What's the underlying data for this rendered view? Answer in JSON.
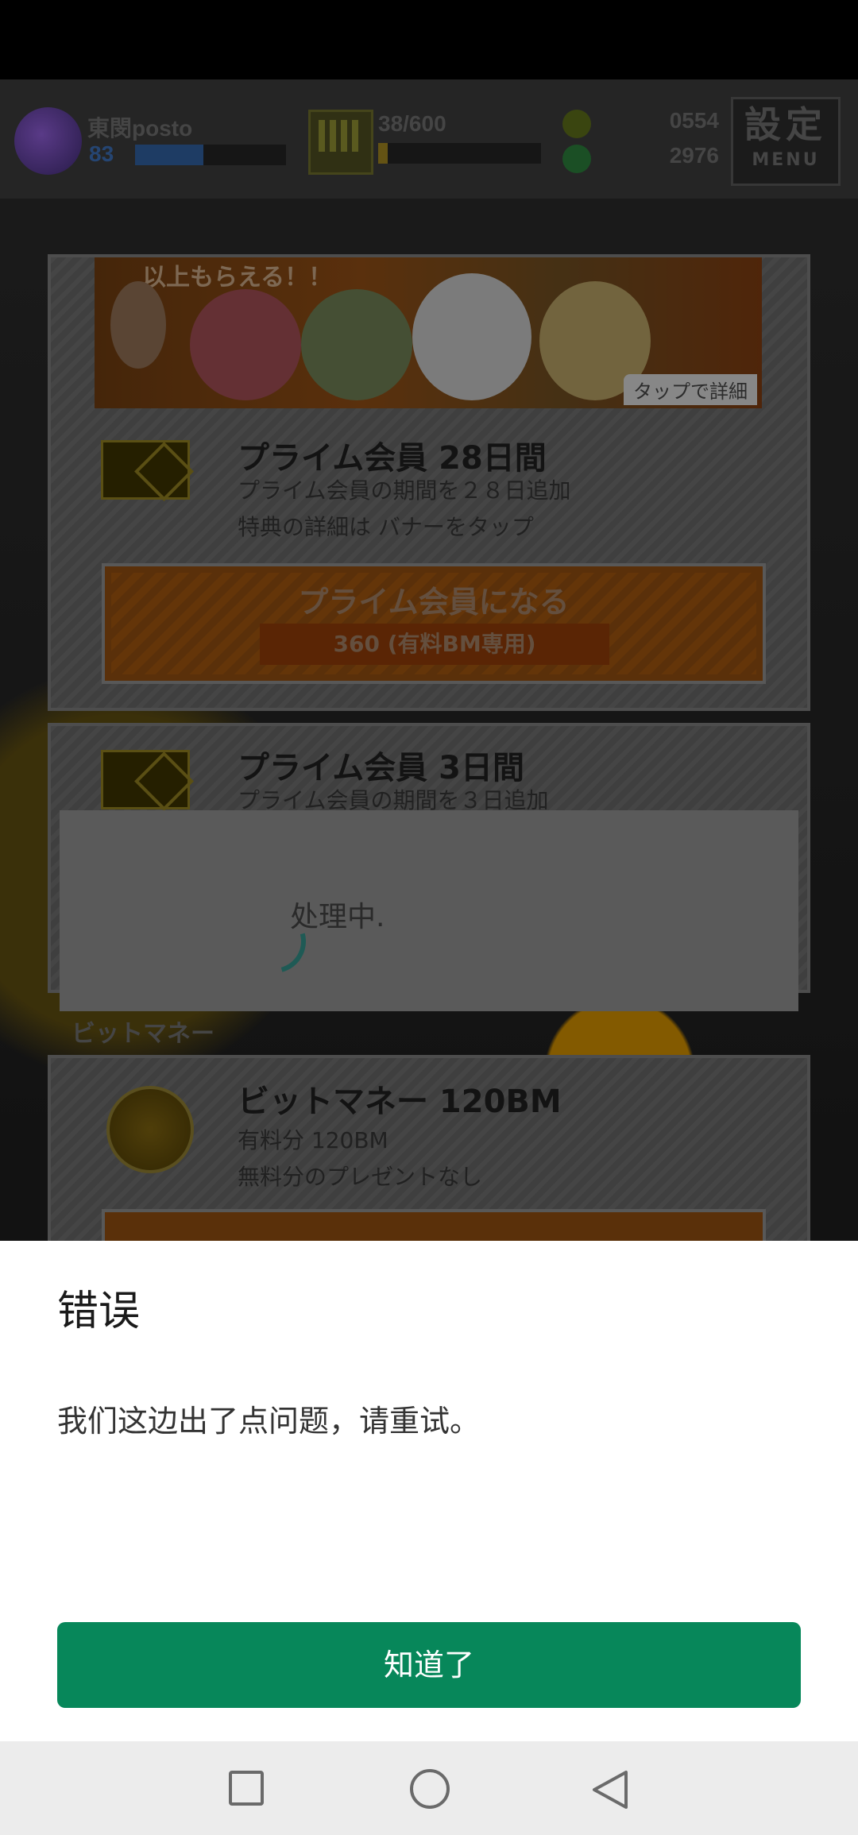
{
  "hud": {
    "player_name": "東閔posto",
    "player_level": "83",
    "stamina": "38/600",
    "money_paid": "0554",
    "money_free": "2976",
    "menu_big": "設定",
    "menu_small": "MENU"
  },
  "shop": {
    "banner_top": "以上もらえる！！",
    "banner_tag": "タップで詳細",
    "card1": {
      "title": "プライム会員 28日間",
      "line1": "プライム会員の期間を２８日追加",
      "line2": "特典の詳細は バナーをタップ",
      "button_label": "プライム会員になる",
      "price": "360 (有料BM専用)"
    },
    "card2": {
      "title": "プライム会員 3日間",
      "line1": "プライム会員の期間を３日追加"
    },
    "section_label": "ビットマネー",
    "card3": {
      "title": "ビットマネー 120BM",
      "line1": "有料分 120BM",
      "line2": "無料分のプレゼントなし"
    }
  },
  "processing": {
    "text": "处理中."
  },
  "error_sheet": {
    "title": "错误",
    "message": "我们这边出了点问题，请重试。",
    "ok_label": "知道了"
  },
  "colors": {
    "accent": "#07875a",
    "sheet_bg": "#ffffff",
    "nav_bg": "#ececec"
  }
}
